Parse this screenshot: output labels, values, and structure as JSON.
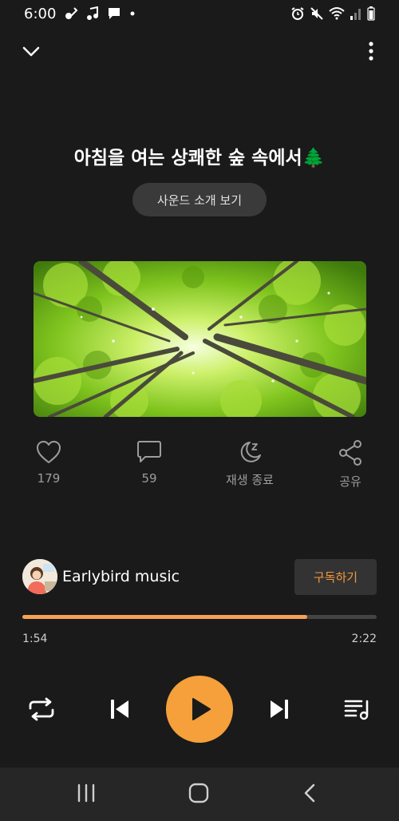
{
  "status_bar": {
    "time": "6:00"
  },
  "header": {
    "collapse_icon": "chevron-down-icon",
    "more_icon": "more-vert-icon"
  },
  "track": {
    "title": "아침을 여는 상쾌한 숲 속에서🌲",
    "intro_button": "사운드 소개 보기"
  },
  "actions": {
    "like": {
      "icon": "heart-icon",
      "label": "179"
    },
    "comment": {
      "icon": "comment-icon",
      "label": "59"
    },
    "sleep_timer": {
      "icon": "moon-zz-icon",
      "label": "재생 종료"
    },
    "share": {
      "icon": "share-icon",
      "label": "공유"
    }
  },
  "channel": {
    "name": "Earlybird music",
    "subscribe_label": "구독하기"
  },
  "playback": {
    "current_time": "1:54",
    "total_time": "2:22",
    "progress_fraction": 0.803
  },
  "colors": {
    "accent": "#f5a03a",
    "background": "#1a1a1a",
    "subscribe_text": "#f5973d"
  },
  "controls": {
    "repeat_icon": "repeat-icon",
    "prev_icon": "skip-previous-icon",
    "play_icon": "play-icon",
    "next_icon": "skip-next-icon",
    "playlist_icon": "playlist-music-icon"
  }
}
